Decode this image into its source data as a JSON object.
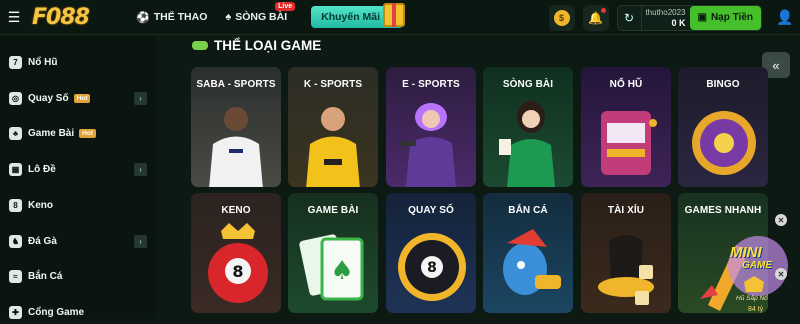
{
  "header": {
    "menu_icon": "hamburger-icon",
    "logo": "F088",
    "nav": [
      {
        "label": "THỂ THAO",
        "icon": "soccer-ball-icon"
      },
      {
        "label": "SÒNG BÀI",
        "icon": "chip-icon",
        "badge": "Live"
      }
    ],
    "promo_label": "Khuyến Mãi",
    "username": "thutho2023",
    "balance": "0 K",
    "deposit_label": "Nạp Tiền"
  },
  "sidebar": {
    "items": [
      {
        "label": "Nổ Hũ",
        "hot": "",
        "arrow": false
      },
      {
        "label": "Quay Số",
        "hot": "Hot",
        "arrow": true
      },
      {
        "label": "Game Bài",
        "hot": "Hot",
        "arrow": false
      },
      {
        "label": "Lô Đề",
        "hot": "",
        "arrow": true
      },
      {
        "label": "Keno",
        "hot": "",
        "arrow": false
      },
      {
        "label": "Đá Gà",
        "hot": "",
        "arrow": true
      },
      {
        "label": "Bắn Cá",
        "hot": "",
        "arrow": false
      },
      {
        "label": "Cổng Game",
        "hot": "",
        "arrow": false
      }
    ]
  },
  "main": {
    "section_title": "THỂ LOẠI GAME",
    "tiles": [
      {
        "title": "SABA - SPORTS"
      },
      {
        "title": "K - SPORTS"
      },
      {
        "title": "E - SPORTS"
      },
      {
        "title": "SÒNG BÀI"
      },
      {
        "title": "NỔ HŨ"
      },
      {
        "title": "BINGO"
      },
      {
        "title": "KENO"
      },
      {
        "title": "GAME BÀI"
      },
      {
        "title": "QUAY SỐ"
      },
      {
        "title": "BẮN CÁ"
      },
      {
        "title": "TÀI XỈU"
      },
      {
        "title": "GAMES NHANH"
      }
    ]
  },
  "floating_banner": {
    "line1": "MINI",
    "line2": "GAME",
    "subtitle": "Hũ Sắp Nổ",
    "amount": "84 tỷ"
  },
  "colors": {
    "accent_green": "#45c02b",
    "logo_gold": "#f6c544",
    "hot_badge": "#e0a23b",
    "live_badge": "#e32b2b"
  }
}
